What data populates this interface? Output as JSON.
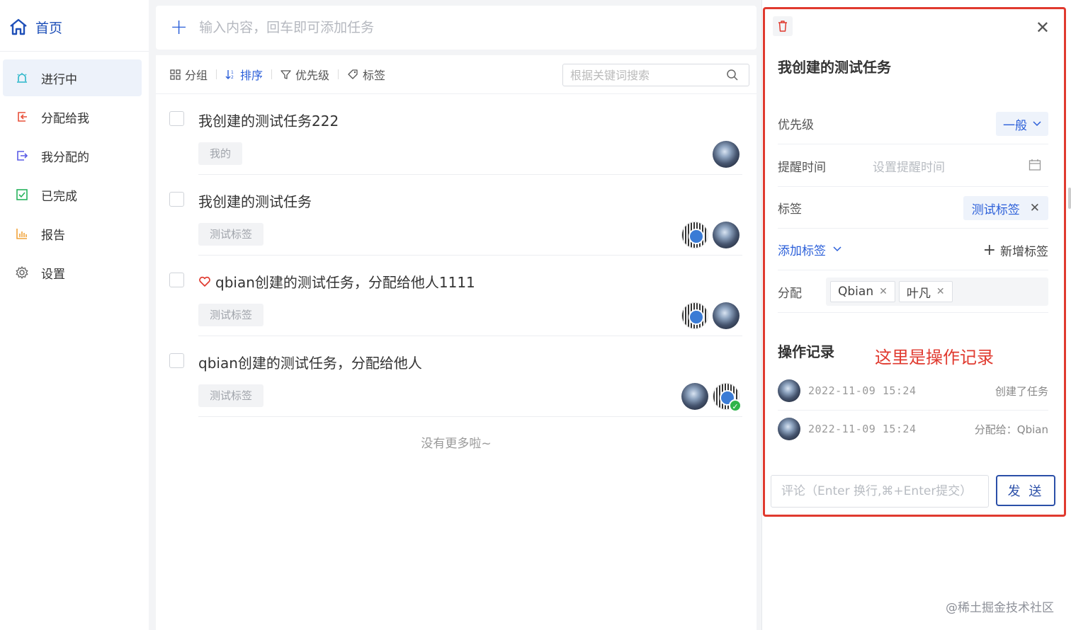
{
  "sidebar": {
    "home_label": "首页",
    "items": [
      {
        "label": "进行中",
        "icon": "alarm-icon",
        "color": "#2ab6c9",
        "active": true
      },
      {
        "label": "分配给我",
        "icon": "assign-in-icon",
        "color": "#e8503a",
        "active": false
      },
      {
        "label": "我分配的",
        "icon": "assign-out-icon",
        "color": "#5a5ce6",
        "active": false
      },
      {
        "label": "已完成",
        "icon": "check-square-icon",
        "color": "#27b35d",
        "active": false
      },
      {
        "label": "报告",
        "icon": "bar-chart-icon",
        "color": "#f2a33a",
        "active": false
      },
      {
        "label": "设置",
        "icon": "gear-icon",
        "color": "#666666",
        "active": false
      }
    ]
  },
  "add_task": {
    "placeholder": "输入内容，回车即可添加任务"
  },
  "toolbar": {
    "group": "分组",
    "sort": "排序",
    "priority": "优先级",
    "tags": "标签",
    "search_placeholder": "根据关键词搜索"
  },
  "tasks": [
    {
      "title": "我创建的测试任务222",
      "tag": "我的",
      "favorite": false
    },
    {
      "title": "我创建的测试任务",
      "tag": "测试标签",
      "favorite": false
    },
    {
      "title": "qbian创建的测试任务，分配给他人1111",
      "tag": "测试标签",
      "favorite": true
    },
    {
      "title": "qbian创建的测试任务，分配给他人",
      "tag": "测试标签",
      "favorite": false
    }
  ],
  "no_more": "没有更多啦~",
  "detail": {
    "title": "我创建的测试任务",
    "priority_label": "优先级",
    "priority_value": "一般",
    "reminder_label": "提醒时间",
    "reminder_placeholder": "设置提醒时间",
    "tag_label": "标签",
    "tag_value": "测试标签",
    "add_tag": "添加标签",
    "new_tag": "新增标签",
    "assign_label": "分配",
    "assignees": [
      "Qbian",
      "叶凡"
    ],
    "log_title": "操作记录",
    "log_note": "这里是操作记录",
    "logs": [
      {
        "time": "2022-11-09 15:24",
        "action": "创建了任务"
      },
      {
        "time": "2022-11-09 15:24",
        "action": "分配给：Qbian"
      }
    ],
    "comment_placeholder": "评论（Enter 换行,⌘+Enter提交）",
    "send_label": "发 送"
  },
  "watermark": "@稀土掘金技术社区",
  "colors": {
    "accent": "#2b5fd9",
    "highlight_border": "#e03a2f"
  }
}
